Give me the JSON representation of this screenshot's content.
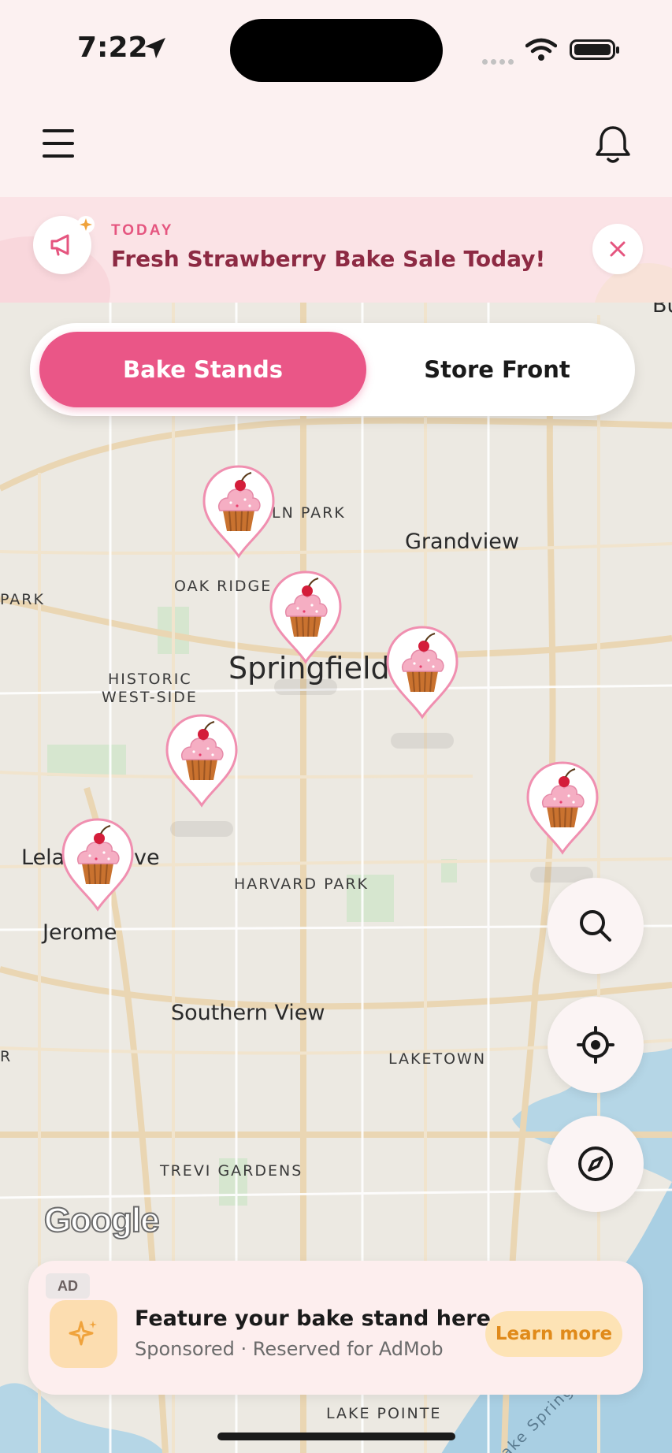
{
  "status_bar": {
    "time": "7:22"
  },
  "banner": {
    "tag": "TODAY",
    "title": "Fresh Strawberry Bake Sale Today!"
  },
  "segment": {
    "options": [
      {
        "label": "Bake Stands",
        "active": true
      },
      {
        "label": "Store Front",
        "active": false
      }
    ]
  },
  "map": {
    "labels": [
      "LN PARK",
      "Grandview",
      "OAK RIDGE",
      "PARK",
      "Springfield",
      "HISTORIC",
      "WEST-SIDE",
      "Lela",
      "ve",
      "HARVARD PARK",
      "Jerome",
      "Southern View",
      "LAKETOWN",
      "TREVI GARDENS",
      "LAKE POINTE",
      "Bu",
      "R",
      "ake Springf"
    ],
    "pin_icon": "cupcake-icon",
    "attribution": "Google"
  },
  "ad": {
    "tag": "AD",
    "title": "Feature your bake stand here",
    "subtitle": "Sponsored · Reserved for AdMob",
    "cta": "Learn more"
  },
  "colors": {
    "accent": "#ea5687",
    "banner_title": "#8d2a43",
    "banner_bg": "#fbe3e6",
    "ad_cta_bg": "#fde3b5",
    "ad_cta_text": "#e08a1a",
    "map_bg": "#ece9e2",
    "road": "#ead6b3"
  }
}
